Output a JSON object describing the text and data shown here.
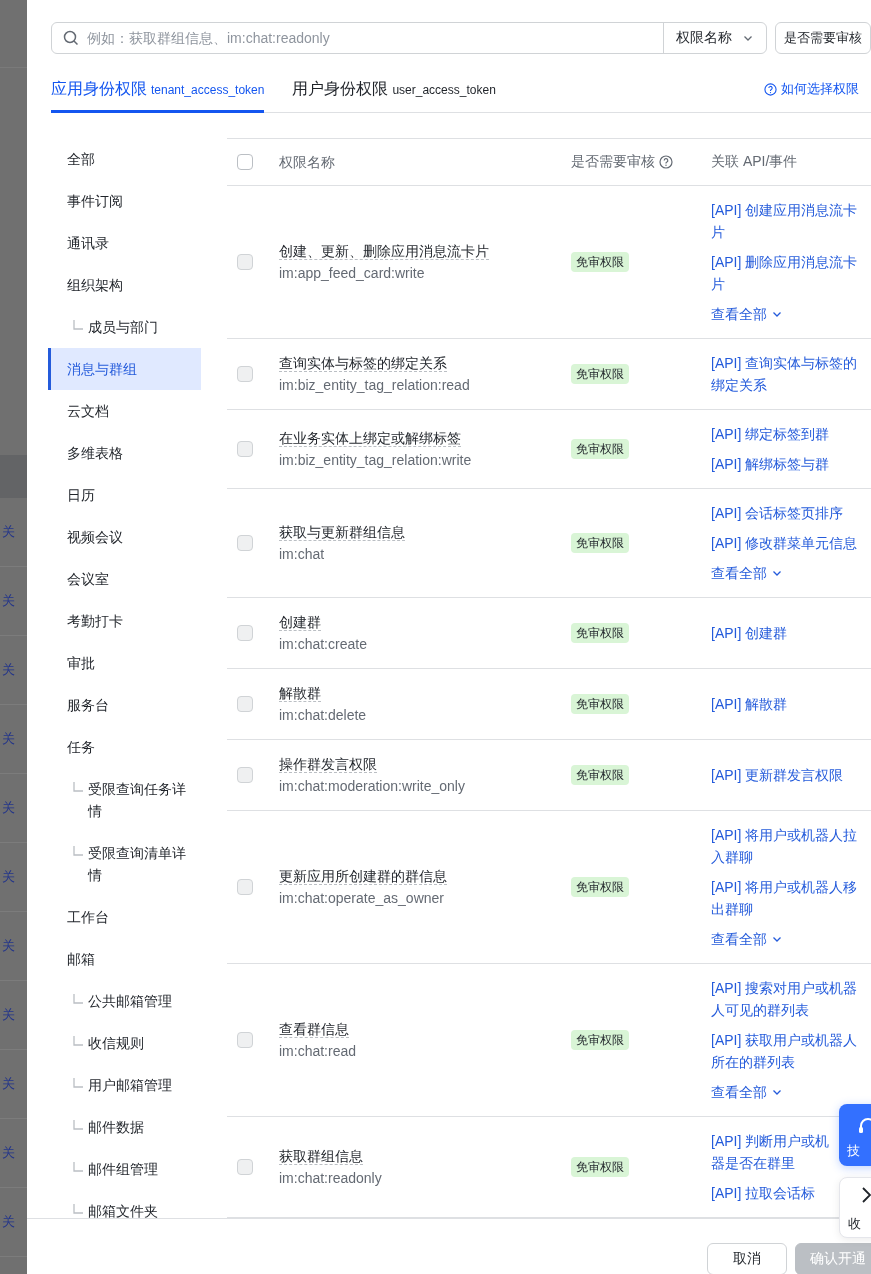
{
  "backdrop": {
    "links": [
      "关",
      "关",
      "关",
      "关",
      "关",
      "关",
      "关",
      "关",
      "关",
      "关",
      "关"
    ]
  },
  "search": {
    "placeholder": "例如：获取群组信息、im:chat:readonly",
    "field_select": "权限名称",
    "filter_select": "是否需要审核"
  },
  "tabs": [
    {
      "label": "应用身份权限",
      "token": "tenant_access_token",
      "selected": true
    },
    {
      "label": "用户身份权限",
      "token": "user_access_token",
      "selected": false
    }
  ],
  "help_link": "如何选择权限",
  "sidebar": {
    "items": [
      {
        "label": "全部",
        "selected": false
      },
      {
        "label": "事件订阅",
        "selected": false
      },
      {
        "label": "通讯录",
        "selected": false
      },
      {
        "label": "组织架构",
        "selected": false,
        "children": [
          {
            "label": "成员与部门",
            "selected": false
          }
        ]
      },
      {
        "label": "消息与群组",
        "selected": true
      },
      {
        "label": "云文档",
        "selected": false
      },
      {
        "label": "多维表格",
        "selected": false
      },
      {
        "label": "日历",
        "selected": false
      },
      {
        "label": "视频会议",
        "selected": false
      },
      {
        "label": "会议室",
        "selected": false
      },
      {
        "label": "考勤打卡",
        "selected": false
      },
      {
        "label": "审批",
        "selected": false
      },
      {
        "label": "服务台",
        "selected": false
      },
      {
        "label": "任务",
        "selected": false,
        "children": [
          {
            "label": "受限查询任务详情",
            "selected": false
          },
          {
            "label": "受限查询清单详情",
            "selected": false
          }
        ]
      },
      {
        "label": "工作台",
        "selected": false
      },
      {
        "label": "邮箱",
        "selected": false,
        "children": [
          {
            "label": "公共邮箱管理",
            "selected": false
          },
          {
            "label": "收信规则",
            "selected": false
          },
          {
            "label": "用户邮箱管理",
            "selected": false
          },
          {
            "label": "邮件数据",
            "selected": false
          },
          {
            "label": "邮件组管理",
            "selected": false
          },
          {
            "label": "邮箱文件夹",
            "selected": false
          }
        ]
      }
    ]
  },
  "table": {
    "columns": [
      "权限名称",
      "是否需要审核",
      "关联 API/事件"
    ],
    "select_all": {
      "checked": false,
      "disabled": false
    },
    "rows": [
      {
        "name": "创建、更新、删除应用消息流卡片",
        "scope": "im:app_feed_card:write",
        "review": "免审权限",
        "checked": false,
        "disabled": true,
        "apis": [
          "[API] 创建应用消息流卡片",
          "[API] 删除应用消息流卡片"
        ],
        "more": "查看全部"
      },
      {
        "name": "查询实体与标签的绑定关系",
        "scope": "im:biz_entity_tag_relation:read",
        "review": "免审权限",
        "checked": false,
        "disabled": true,
        "apis": [
          "[API] 查询实体与标签的绑定关系"
        ]
      },
      {
        "name": "在业务实体上绑定或解绑标签",
        "scope": "im:biz_entity_tag_relation:write",
        "review": "免审权限",
        "checked": false,
        "disabled": true,
        "apis": [
          "[API] 绑定标签到群",
          "[API] 解绑标签与群"
        ]
      },
      {
        "name": "获取与更新群组信息",
        "scope": "im:chat",
        "review": "免审权限",
        "checked": false,
        "disabled": true,
        "apis": [
          "[API] 会话标签页排序",
          "[API] 修改群菜单元信息"
        ],
        "more": "查看全部"
      },
      {
        "name": "创建群",
        "scope": "im:chat:create",
        "review": "免审权限",
        "checked": false,
        "disabled": true,
        "apis": [
          "[API] 创建群"
        ]
      },
      {
        "name": "解散群",
        "scope": "im:chat:delete",
        "review": "免审权限",
        "checked": false,
        "disabled": true,
        "apis": [
          "[API] 解散群"
        ]
      },
      {
        "name": "操作群发言权限",
        "scope": "im:chat:moderation:write_only",
        "review": "免审权限",
        "checked": false,
        "disabled": true,
        "apis": [
          "[API] 更新群发言权限"
        ]
      },
      {
        "name": "更新应用所创建群的群信息",
        "scope": "im:chat:operate_as_owner",
        "review": "免审权限",
        "checked": false,
        "disabled": true,
        "apis": [
          "[API] 将用户或机器人拉入群聊",
          "[API] 将用户或机器人移出群聊"
        ],
        "more": "查看全部"
      },
      {
        "name": "查看群信息",
        "scope": "im:chat:read",
        "review": "免审权限",
        "checked": false,
        "disabled": true,
        "apis": [
          "[API] 搜索对用户或机器人可见的群列表",
          "[API] 获取用户或机器人所在的群列表"
        ],
        "more": "查看全部"
      },
      {
        "name": "获取群组信息",
        "scope": "im:chat:readonly",
        "review": "免审权限",
        "checked": false,
        "disabled": true,
        "apis": [
          "[API] 判断用户或机器是否在群里",
          "[API] 拉取会话标"
        ]
      }
    ]
  },
  "footer": {
    "buttons": [
      {
        "label": "取消",
        "disabled": false
      },
      {
        "label": "确认开通",
        "disabled": true
      }
    ]
  },
  "float": {
    "support": "技",
    "collapse": "收"
  }
}
